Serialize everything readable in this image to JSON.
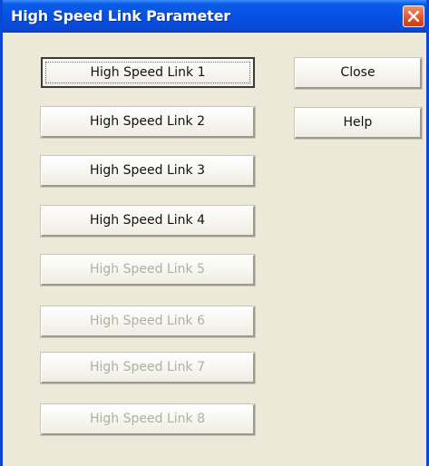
{
  "window": {
    "title": "High Speed Link Parameter"
  },
  "link_buttons": [
    {
      "label": "High Speed Link 1",
      "enabled": true,
      "focused": true
    },
    {
      "label": "High Speed Link 2",
      "enabled": true,
      "focused": false
    },
    {
      "label": "High Speed Link 3",
      "enabled": true,
      "focused": false
    },
    {
      "label": "High Speed Link 4",
      "enabled": true,
      "focused": false
    },
    {
      "label": "High Speed Link 5",
      "enabled": false,
      "focused": false
    },
    {
      "label": "High Speed Link 6",
      "enabled": false,
      "focused": false
    },
    {
      "label": "High Speed Link 7",
      "enabled": false,
      "focused": false
    },
    {
      "label": "High Speed Link 8",
      "enabled": false,
      "focused": false
    }
  ],
  "side_buttons": {
    "close_label": "Close",
    "help_label": "Help"
  },
  "icons": {
    "close": "close-icon"
  },
  "colors": {
    "title_bar": "#0551e6",
    "close_button": "#e25429",
    "dialog_background": "#ece9d8",
    "disabled_text": "#aeb1a2"
  }
}
